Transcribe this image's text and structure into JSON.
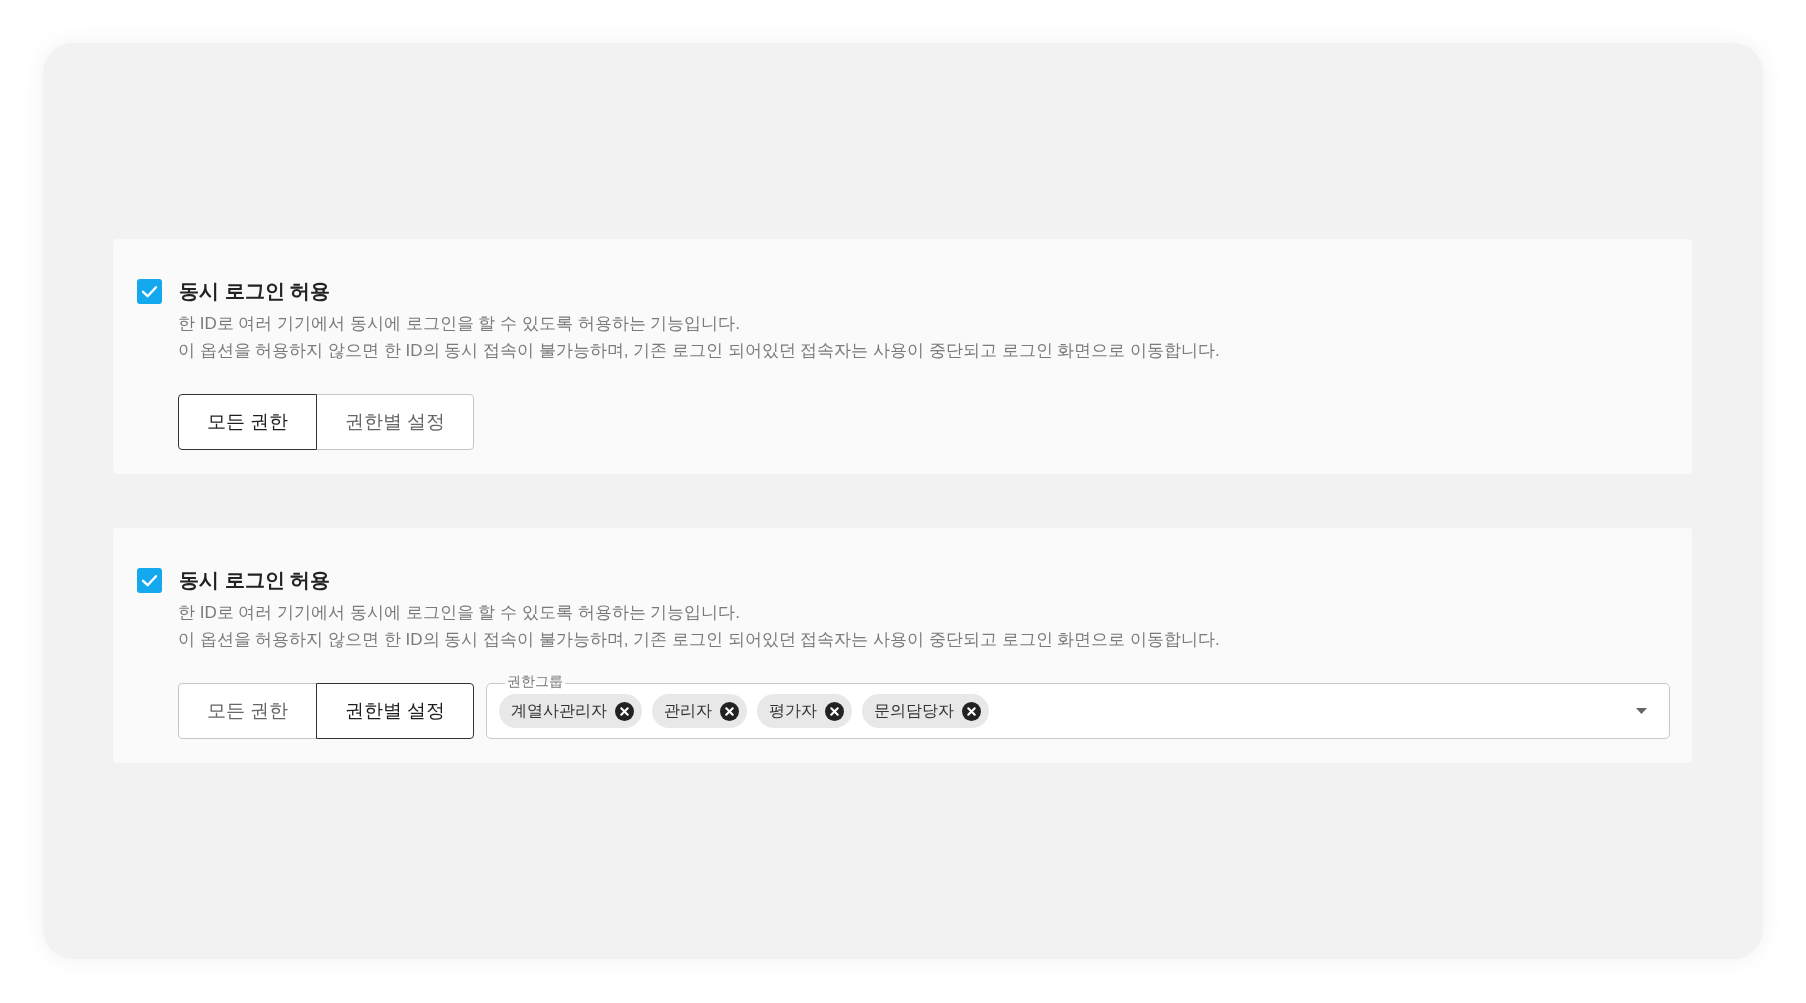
{
  "sections": [
    {
      "checkbox": {
        "label": "동시 로그인 허용",
        "checked": true
      },
      "description": [
        "한 ID로 여러 기기에서 동시에 로그인을 할 수 있도록 허용하는 기능입니다.",
        "이 옵션을 허용하지 않으면 한 ID의 동시 접속이 불가능하며, 기존 로그인 되어있던 접속자는 사용이 중단되고 로그인 화면으로 이동합니다."
      ],
      "scope_options": [
        {
          "label": "모든 권한",
          "selected": true
        },
        {
          "label": "권한별 설정",
          "selected": false
        }
      ]
    },
    {
      "checkbox": {
        "label": "동시 로그인 허용",
        "checked": true
      },
      "description": [
        "한 ID로 여러 기기에서 동시에 로그인을 할 수 있도록 허용하는 기능입니다.",
        "이 옵션을 허용하지 않으면 한 ID의 동시 접속이 불가능하며, 기존 로그인 되어있던 접속자는 사용이 중단되고 로그인 화면으로 이동합니다."
      ],
      "scope_options": [
        {
          "label": "모든 권한",
          "selected": false
        },
        {
          "label": "권한별 설정",
          "selected": true
        }
      ],
      "role_group_select": {
        "label": "권한그룹",
        "tags": [
          {
            "label": "계열사관리자"
          },
          {
            "label": "관리자"
          },
          {
            "label": "평가자"
          },
          {
            "label": "문의담당자"
          }
        ]
      }
    }
  ]
}
